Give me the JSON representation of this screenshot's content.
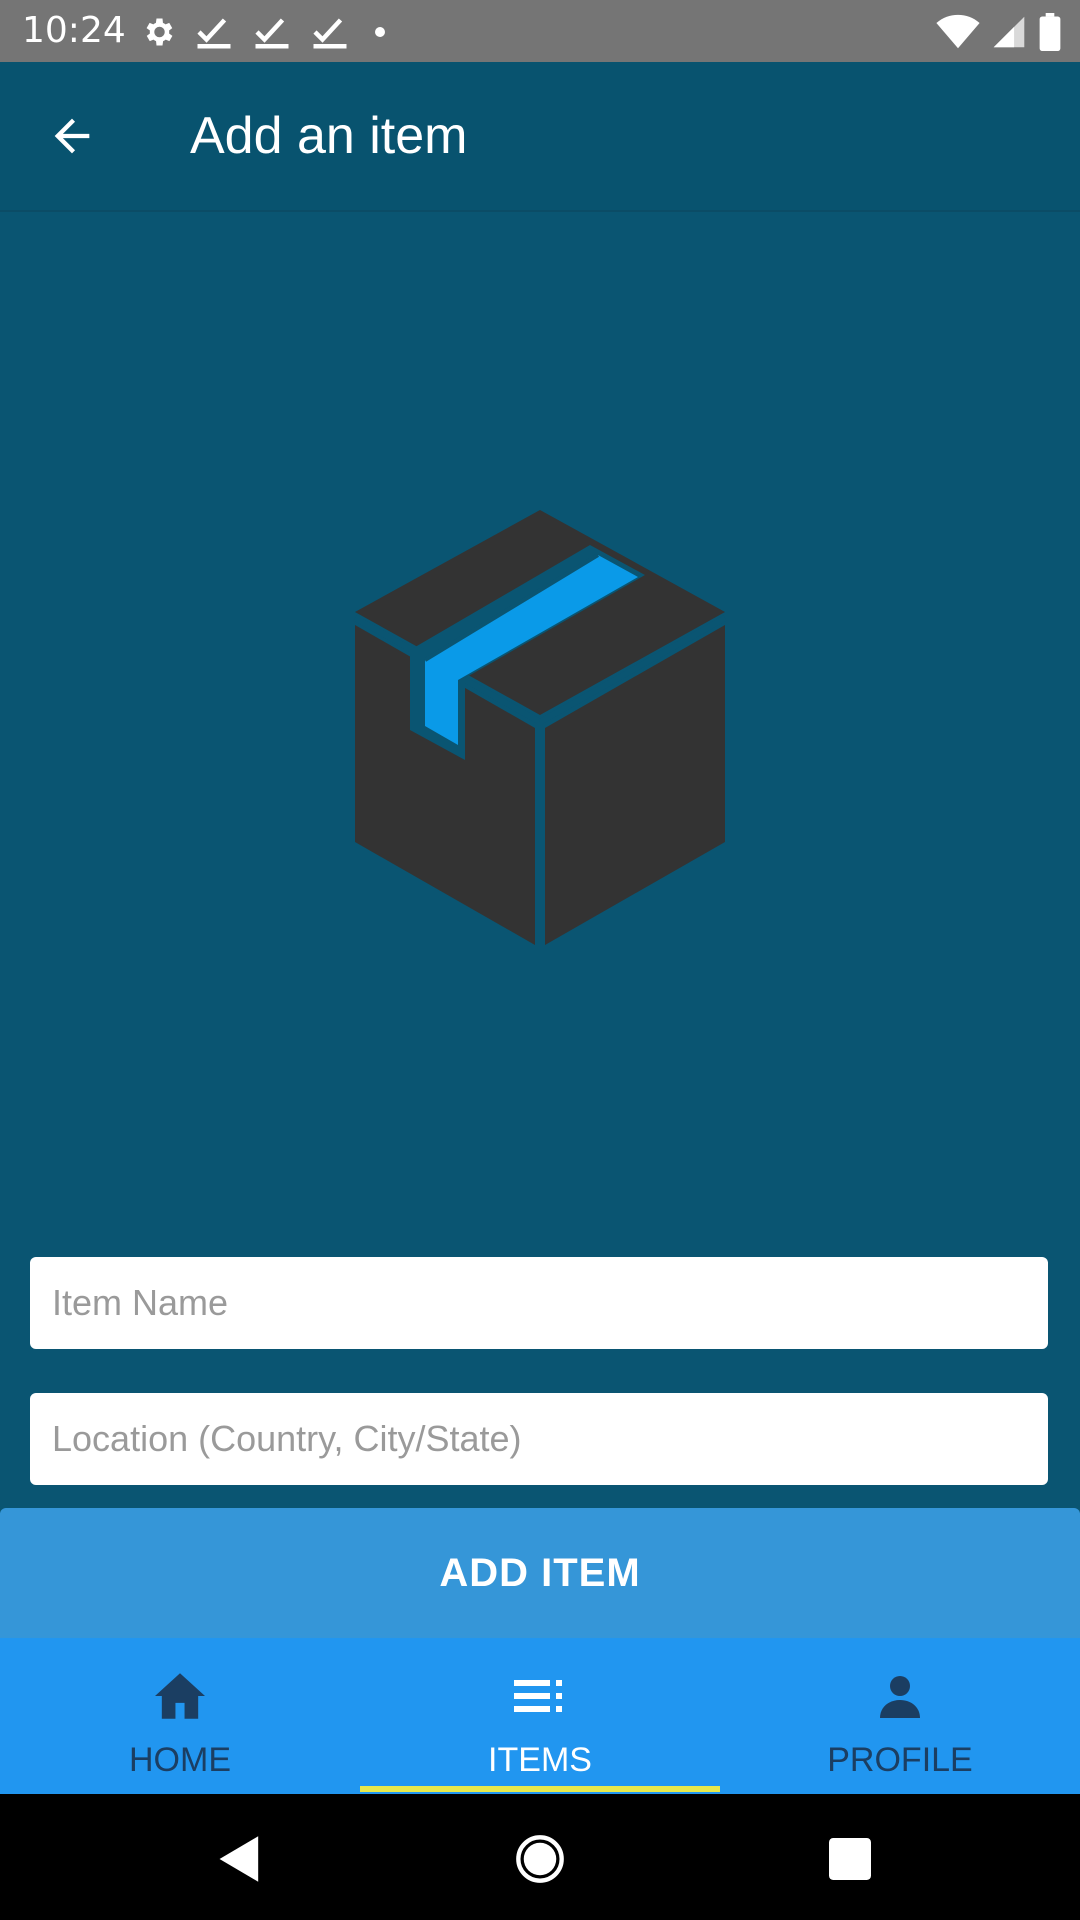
{
  "status_bar": {
    "time": "10:24",
    "left_icons": [
      "settings-icon",
      "check-icon",
      "check-icon",
      "check-icon",
      "dot-icon"
    ],
    "right_icons": [
      "wifi-icon",
      "signal-icon",
      "battery-icon"
    ]
  },
  "app_bar": {
    "title": "Add an item",
    "back_icon": "arrow-back-icon"
  },
  "hero": {
    "icon": "package-box-icon",
    "box_color": "#333333",
    "tape_color": "#0a9ae8"
  },
  "form": {
    "item_name": {
      "value": "",
      "placeholder": "Item Name"
    },
    "location": {
      "value": "",
      "placeholder": "Location (Country, City/State)"
    },
    "submit_label": "ADD ITEM"
  },
  "bottom_nav": {
    "tabs": [
      {
        "label": "HOME",
        "icon": "home-icon",
        "active": false
      },
      {
        "label": "ITEMS",
        "icon": "list-icon",
        "active": true
      },
      {
        "label": "PROFILE",
        "icon": "person-icon",
        "active": false
      }
    ],
    "indicator_color": "#e8e84a"
  },
  "system_nav": {
    "icons": [
      "back-triangle-icon",
      "home-circle-icon",
      "recents-square-icon"
    ]
  },
  "colors": {
    "background": "#0a5572",
    "app_bar": "#08536f",
    "button": "#3596d8",
    "nav": "#2196f0"
  }
}
